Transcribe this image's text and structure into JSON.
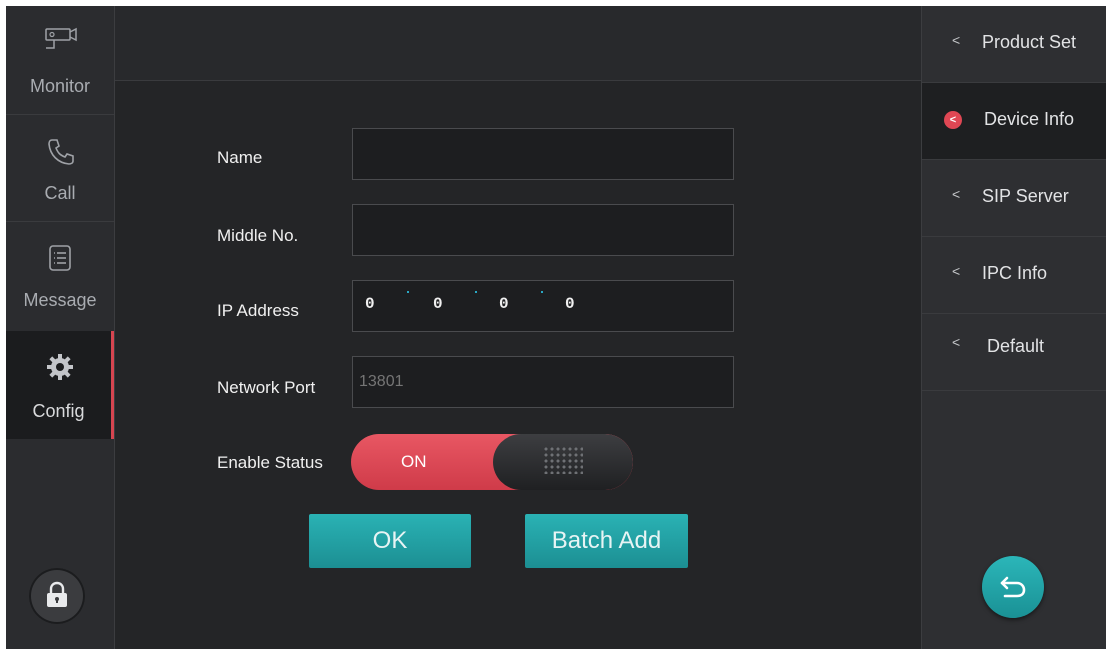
{
  "nav": {
    "items": [
      {
        "label": "Monitor",
        "icon": "camera-icon"
      },
      {
        "label": "Call",
        "icon": "phone-icon"
      },
      {
        "label": "Message",
        "icon": "message-list-icon"
      },
      {
        "label": "Config",
        "icon": "gear-icon",
        "active": true
      }
    ],
    "lock_icon": "lock-icon"
  },
  "form": {
    "name_label": "Name",
    "name_value": "",
    "middle_label": "Middle No.",
    "middle_value": "",
    "ip_label": "IP Address",
    "ip_octets": [
      "0",
      "0",
      "0",
      "0"
    ],
    "port_label": "Network Port",
    "port_placeholder": "13801",
    "enable_label": "Enable Status",
    "toggle_state": "ON",
    "ok_label": "OK",
    "batch_label": "Batch Add"
  },
  "right_menu": {
    "items": [
      {
        "label": "Product Set"
      },
      {
        "label": "Device Info",
        "active": true
      },
      {
        "label": "SIP Server"
      },
      {
        "label": "IPC Info"
      },
      {
        "label": "Default"
      }
    ],
    "back_icon": "back-arrow-icon"
  },
  "colors": {
    "accent_red": "#d64550",
    "accent_teal": "#1fa0a4",
    "background": "#242527"
  }
}
